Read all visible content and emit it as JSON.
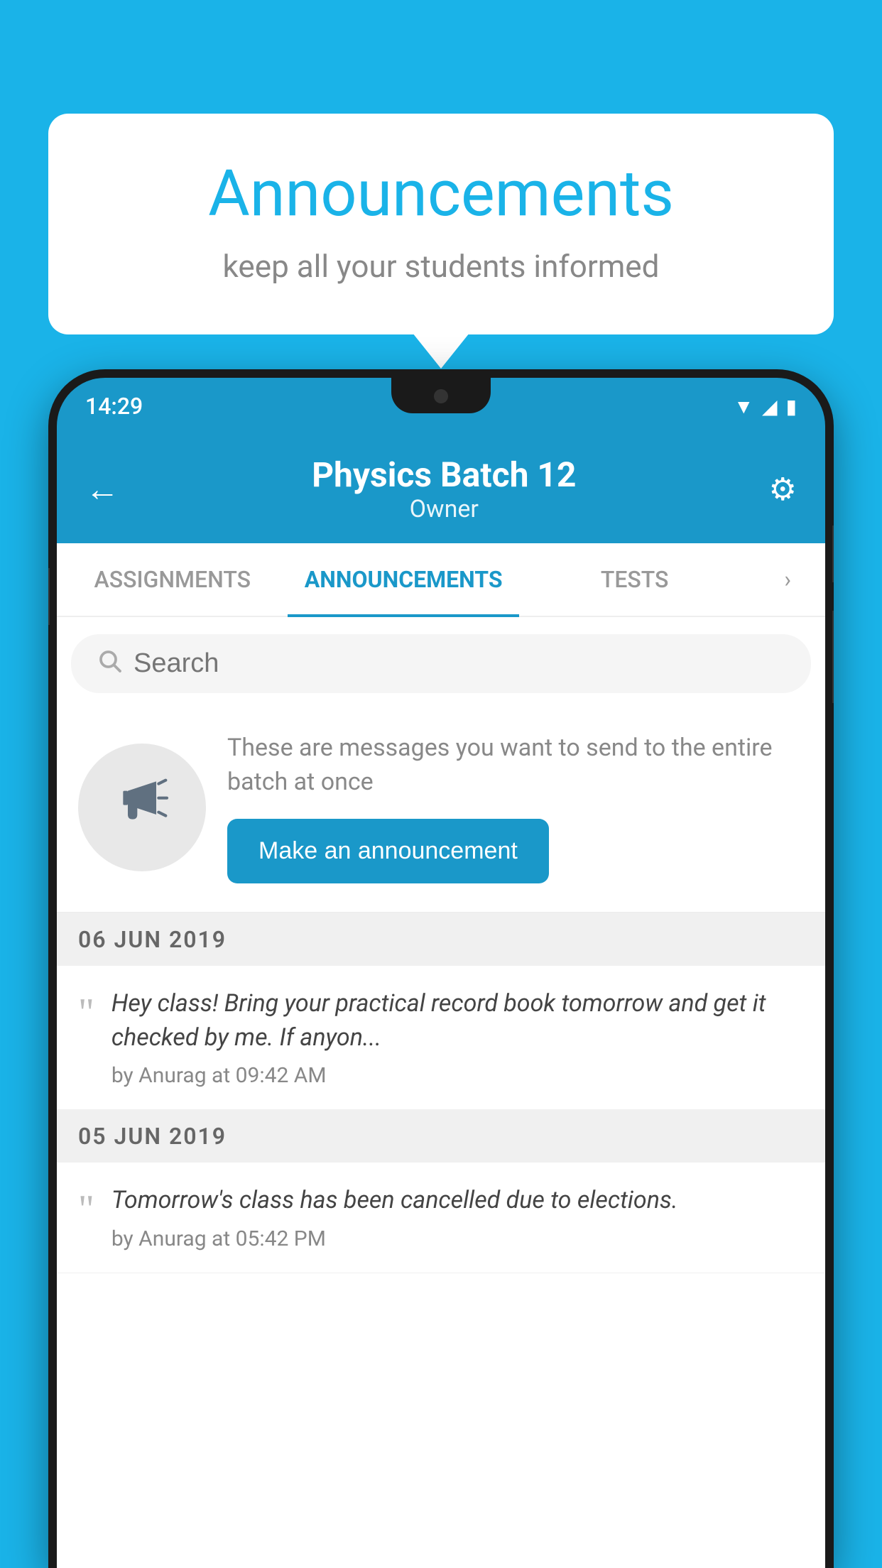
{
  "bubble": {
    "title": "Announcements",
    "subtitle": "keep all your students informed"
  },
  "status_bar": {
    "time": "14:29"
  },
  "header": {
    "title": "Physics Batch 12",
    "subtitle": "Owner",
    "back_label": "←",
    "settings_label": "⚙"
  },
  "tabs": [
    {
      "label": "ASSIGNMENTS",
      "active": false
    },
    {
      "label": "ANNOUNCEMENTS",
      "active": true
    },
    {
      "label": "TESTS",
      "active": false
    }
  ],
  "search": {
    "placeholder": "Search"
  },
  "promo": {
    "text": "These are messages you want to send to the entire batch at once",
    "button_label": "Make an announcement"
  },
  "date_sections": [
    {
      "date": "06  JUN  2019",
      "items": [
        {
          "text": "Hey class! Bring your practical record book tomorrow and get it checked by me. If anyon...",
          "author": "by Anurag at 09:42 AM"
        }
      ]
    },
    {
      "date": "05  JUN  2019",
      "items": [
        {
          "text": "Tomorrow's class has been cancelled due to elections.",
          "author": "by Anurag at 05:42 PM"
        }
      ]
    }
  ]
}
